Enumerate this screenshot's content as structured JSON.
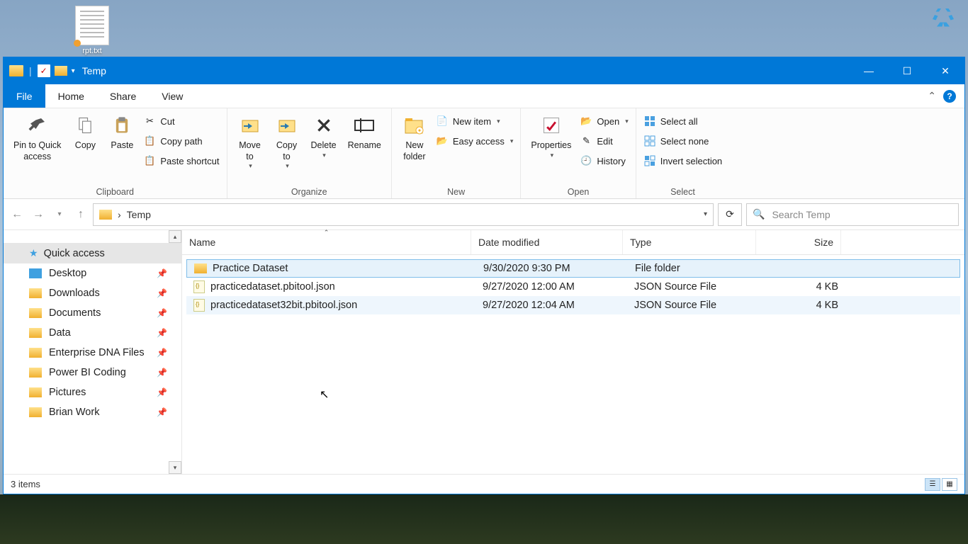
{
  "desktop": {
    "txt_label": "rpt.txt"
  },
  "title": "Temp",
  "tabs": {
    "file": "File",
    "home": "Home",
    "share": "Share",
    "view": "View"
  },
  "ribbon": {
    "clipboard": {
      "label": "Clipboard",
      "pin": "Pin to Quick\naccess",
      "copy": "Copy",
      "paste": "Paste",
      "cut": "Cut",
      "copypath": "Copy path",
      "shortcut": "Paste shortcut"
    },
    "organize": {
      "label": "Organize",
      "moveto": "Move\nto",
      "copyto": "Copy\nto",
      "delete": "Delete",
      "rename": "Rename"
    },
    "new": {
      "label": "New",
      "newfolder": "New\nfolder",
      "newitem": "New item",
      "easy": "Easy access"
    },
    "open": {
      "label": "Open",
      "properties": "Properties",
      "open": "Open",
      "edit": "Edit",
      "history": "History"
    },
    "select": {
      "label": "Select",
      "all": "Select all",
      "none": "Select none",
      "invert": "Invert selection"
    }
  },
  "breadcrumb": {
    "current": "Temp"
  },
  "search_placeholder": "Search Temp",
  "sidebar": {
    "quick": "Quick access",
    "items": [
      {
        "label": "Desktop"
      },
      {
        "label": "Downloads"
      },
      {
        "label": "Documents"
      },
      {
        "label": "Data"
      },
      {
        "label": "Enterprise DNA Files"
      },
      {
        "label": "Power BI Coding"
      },
      {
        "label": "Pictures"
      },
      {
        "label": "Brian Work"
      }
    ]
  },
  "cols": {
    "name": "Name",
    "date": "Date modified",
    "type": "Type",
    "size": "Size"
  },
  "rows": [
    {
      "name": "Practice Dataset",
      "date": "9/30/2020 9:30 PM",
      "type": "File folder",
      "size": "",
      "kind": "folder",
      "sel": true
    },
    {
      "name": "practicedataset.pbitool.json",
      "date": "9/27/2020 12:00 AM",
      "type": "JSON Source File",
      "size": "4 KB",
      "kind": "json"
    },
    {
      "name": "practicedataset32bit.pbitool.json",
      "date": "9/27/2020 12:04 AM",
      "type": "JSON Source File",
      "size": "4 KB",
      "kind": "json",
      "hover": true
    }
  ],
  "status": "3 items"
}
